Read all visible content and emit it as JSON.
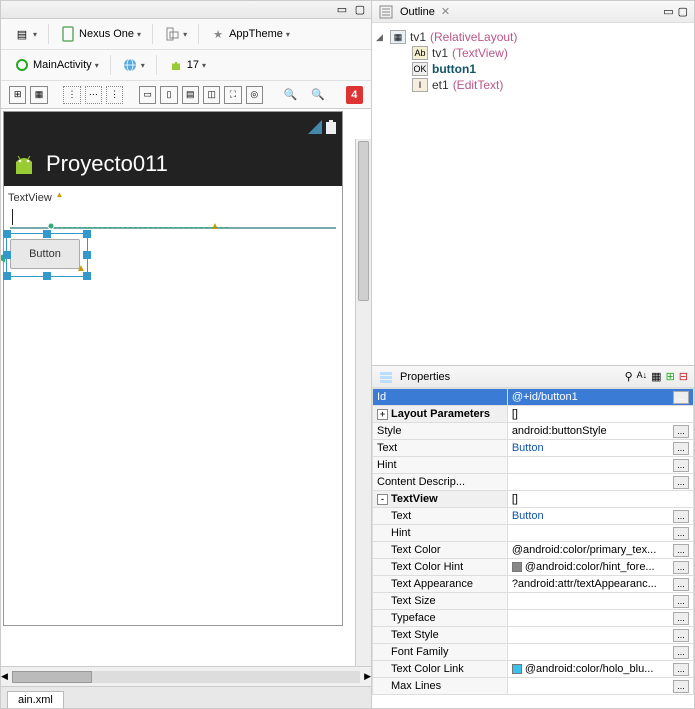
{
  "toolbar": {
    "device": "Nexus One",
    "theme": "AppTheme",
    "activity": "MainActivity",
    "api": "17",
    "warning_count": "4"
  },
  "preview": {
    "app_title": "Proyecto011",
    "textview_text": "TextView",
    "button_text": "Button"
  },
  "tab": {
    "label": "ain.xml"
  },
  "outline": {
    "title": "Outline",
    "root": {
      "id": "tv1",
      "type": "(RelativeLayout)"
    },
    "items": [
      {
        "id": "tv1",
        "type": "(TextView)",
        "badge": "Ab"
      },
      {
        "id": "button1",
        "type": "",
        "badge": "OK",
        "selected": true
      },
      {
        "id": "et1",
        "type": "(EditText)",
        "badge": "I"
      }
    ]
  },
  "properties": {
    "title": "Properties",
    "rows": [
      {
        "k": "Id",
        "v": "@+id/button1",
        "sel": true,
        "btn": true
      },
      {
        "k": "Layout Parameters",
        "v": "[]",
        "grp": true,
        "exp": "+"
      },
      {
        "k": "Style",
        "v": "android:buttonStyle",
        "btn": true
      },
      {
        "k": "Text",
        "v": "Button",
        "link": true,
        "btn": true
      },
      {
        "k": "Hint",
        "v": "",
        "btn": true
      },
      {
        "k": "Content Descrip...",
        "v": "",
        "btn": true
      },
      {
        "k": "TextView",
        "v": "[]",
        "grp": true,
        "exp": "-"
      },
      {
        "k": "Text",
        "v": "Button",
        "indent": true,
        "link": true,
        "btn": true
      },
      {
        "k": "Hint",
        "v": "",
        "indent": true,
        "btn": true
      },
      {
        "k": "Text Color",
        "v": "@android:color/primary_tex...",
        "indent": true,
        "btn": true
      },
      {
        "k": "Text Color Hint",
        "v": "@android:color/hint_fore...",
        "indent": true,
        "btn": true,
        "swatch": "#888"
      },
      {
        "k": "Text Appearance",
        "v": "?android:attr/textAppearanc...",
        "indent": true,
        "btn": true
      },
      {
        "k": "Text Size",
        "v": "",
        "indent": true,
        "btn": true
      },
      {
        "k": "Typeface",
        "v": "",
        "indent": true,
        "btn": true
      },
      {
        "k": "Text Style",
        "v": "",
        "indent": true,
        "btn": true
      },
      {
        "k": "Font Family",
        "v": "",
        "indent": true,
        "btn": true
      },
      {
        "k": "Text Color Link",
        "v": "@android:color/holo_blu...",
        "indent": true,
        "btn": true,
        "swatch": "#39c1e8"
      },
      {
        "k": "Max Lines",
        "v": "",
        "indent": true,
        "btn": true
      }
    ]
  }
}
